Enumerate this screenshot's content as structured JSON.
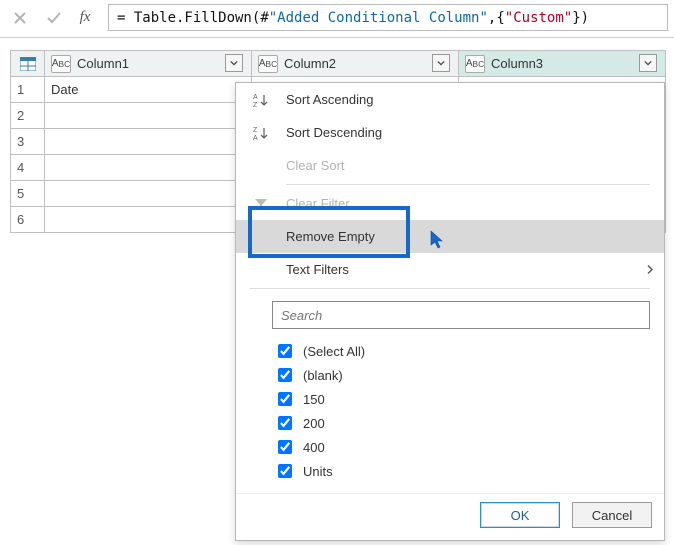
{
  "formula": {
    "text": "= Table.FillDown(#\"Added Conditional Column\",{\"Custom\"})",
    "eq": "= ",
    "fn": "Table.FillDown",
    "open": "(",
    "arg1_hash": "#",
    "arg1_str": "\"Added Conditional Column\"",
    "comma": ",",
    "arg2_open": "{",
    "arg2_str": "\"Custom\"",
    "arg2_close": "}",
    "close": ")"
  },
  "columns": [
    "Column1",
    "Column2",
    "Column3"
  ],
  "rows": [
    {
      "n": "1",
      "c1": "Date"
    },
    {
      "n": "2",
      "c1": ""
    },
    {
      "n": "3",
      "c1": ""
    },
    {
      "n": "4",
      "c1": ""
    },
    {
      "n": "5",
      "c1": ""
    },
    {
      "n": "6",
      "c1": ""
    }
  ],
  "menu": {
    "sort_asc": "Sort Ascending",
    "sort_desc": "Sort Descending",
    "clear_sort": "Clear Sort",
    "clear_filter": "Clear Filter",
    "remove_empty": "Remove Empty",
    "text_filters": "Text Filters",
    "search_placeholder": "Search"
  },
  "filter_values": [
    "(Select All)",
    "(blank)",
    "150",
    "200",
    "400",
    "Units"
  ],
  "buttons": {
    "ok": "OK",
    "cancel": "Cancel"
  }
}
